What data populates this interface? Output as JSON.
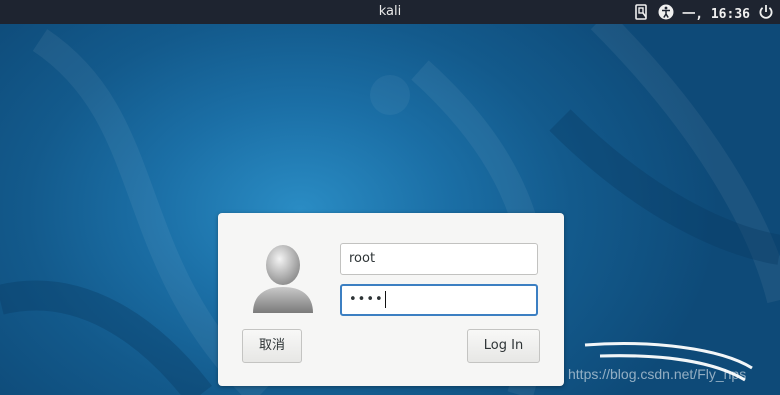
{
  "top_bar": {
    "title": "kali",
    "clock": "一, 16:36",
    "icons": [
      "keyboard-layout-icon",
      "accessibility-icon",
      "power-icon"
    ]
  },
  "login": {
    "username_value": "root",
    "password_mask": "••••",
    "cancel_label": "取消",
    "login_label": "Log In",
    "focus_color": "#3c7fc2"
  },
  "colors": {
    "background": "#1b6fa6",
    "panel": "#1e2430",
    "dialog": "#f6f6f5"
  },
  "watermark": "https://blog.csdn.net/Fly_hps"
}
